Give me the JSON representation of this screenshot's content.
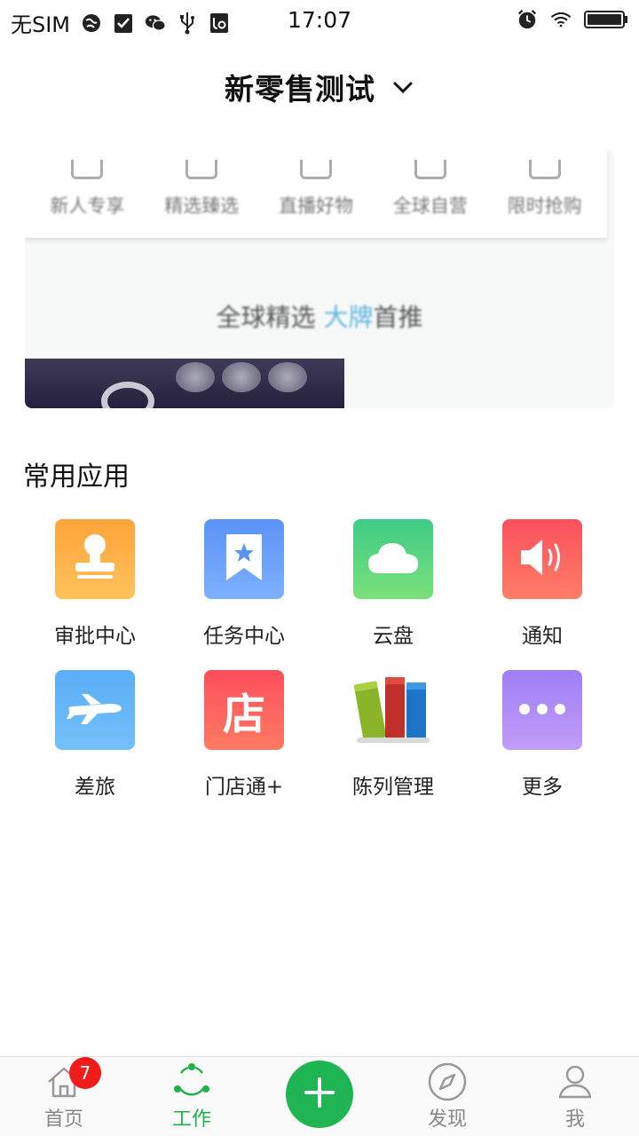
{
  "status_bar": {
    "carrier": "无SIM",
    "time": "17:07",
    "icons": [
      "globe-icon",
      "check-icon",
      "wechat-icon",
      "usb-icon",
      "debug-icon",
      "alarm-icon",
      "wifi-icon",
      "battery-icon"
    ]
  },
  "header": {
    "title": "新零售测试",
    "dropdown_icon": "chevron-down-icon"
  },
  "banner": {
    "categories": [
      "新人专享",
      "精选臻选",
      "直播好物",
      "全球自营",
      "限时抢购"
    ],
    "slogan_prefix": "全球精选 ",
    "slogan_highlight": "大牌",
    "slogan_suffix": "首推"
  },
  "common_apps": {
    "title": "常用应用",
    "items": [
      {
        "label": "审批中心",
        "icon": "stamp-icon",
        "color": "#ffa43a"
      },
      {
        "label": "任务中心",
        "icon": "bookmark-star-icon",
        "color": "#5b93f6"
      },
      {
        "label": "云盘",
        "icon": "cloud-icon",
        "color": "#3ecb86"
      },
      {
        "label": "通知",
        "icon": "speaker-icon",
        "color": "#fc5960"
      },
      {
        "label": "差旅",
        "icon": "airplane-icon",
        "color": "#5db4f6"
      },
      {
        "label": "门店通+",
        "icon": "store-icon",
        "icon_text": "店",
        "color": "#fb5b5d"
      },
      {
        "label": "陈列管理",
        "icon": "books-icon",
        "color": "#ffffff"
      },
      {
        "label": "更多",
        "icon": "more-icon",
        "color": "#a587f6"
      }
    ]
  },
  "tab_bar": {
    "accent": "#21b04b",
    "tabs": [
      {
        "label": "首页",
        "icon": "home-icon",
        "badge": "7"
      },
      {
        "label": "工作",
        "icon": "work-icon",
        "active": true
      },
      {
        "label": "",
        "icon": "plus-icon"
      },
      {
        "label": "发现",
        "icon": "compass-icon"
      },
      {
        "label": "我",
        "icon": "person-icon"
      }
    ]
  }
}
